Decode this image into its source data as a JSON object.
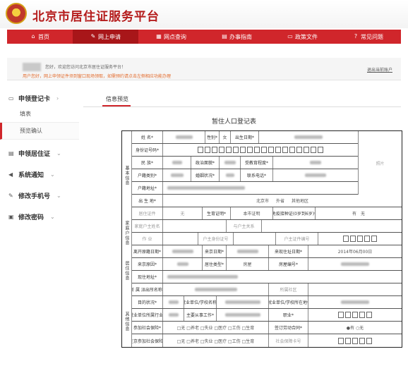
{
  "header": {
    "title": "北京市居住证服务平台"
  },
  "nav": [
    {
      "label": "首页",
      "icon": "home-icon",
      "glyph": "⌂"
    },
    {
      "label": "网上申请",
      "icon": "edit-icon",
      "glyph": "✎",
      "active": true
    },
    {
      "label": "网点查询",
      "icon": "map-icon",
      "glyph": "▦"
    },
    {
      "label": "办事指南",
      "icon": "guide-icon",
      "glyph": "▤"
    },
    {
      "label": "政策文件",
      "icon": "document-icon",
      "glyph": "▭"
    },
    {
      "label": "常见问题",
      "icon": "question-icon",
      "glyph": "?"
    }
  ],
  "welcome": {
    "greeting": "您好，欢迎您访问北京市居住证服务平台！",
    "note": "用户您好，网上申领证件须到窗口现场领取，如需预约请点击左侧相应功能办理",
    "logout": "退出当前账户"
  },
  "sidebar": {
    "groups": [
      {
        "label": "申领登记卡",
        "icon": "id-card-icon",
        "glyph": "▭",
        "caret": "›"
      },
      {
        "label": "申领居住证",
        "icon": "card-icon",
        "glyph": "▤",
        "caret": "⌄"
      },
      {
        "label": "系统通知",
        "icon": "speaker-icon",
        "glyph": "◀",
        "caret": "⌄"
      },
      {
        "label": "修改手机号",
        "icon": "edit-icon",
        "glyph": "✎",
        "caret": "⌄"
      },
      {
        "label": "修改密码",
        "icon": "lock-icon",
        "glyph": "▣",
        "caret": "⌄"
      }
    ],
    "subitems": [
      "填表",
      "预览确认"
    ]
  },
  "main": {
    "tab": "信息预览",
    "form_title": "暂住人口登记表"
  },
  "form": {
    "sections": {
      "basic": "基本信息",
      "household": "家庭户信息",
      "residence": "居住信息",
      "other": "其他信息"
    },
    "photo": "照片",
    "labels": {
      "name": "姓 名*",
      "gender": "性别*",
      "gender_value": "女",
      "birth": "出生日期*",
      "id_no": "身份证号码*",
      "ethnic": "民 族*",
      "politics": "政治面貌*",
      "education": "受教育程度*",
      "hukou_type": "户籍类别*",
      "marriage": "婚姻状况*",
      "phone": "联系电话*",
      "hukou_addr": "户籍地址*",
      "birthplace": "出 生 地*",
      "bp_opt1": "北京市",
      "bp_opt2": "外省",
      "bp_opt3": "其他地区",
      "residence_cert": "居住证件",
      "reproductive_cert": "生育证明*",
      "has_cert_opt": "有",
      "none_opt": "无",
      "beijing_cert": "本市证明",
      "exempt": "免疫接种证(0岁到6岁)*",
      "yes_opt": "有",
      "family_head": "家庭户主姓名",
      "head_relation": "与户主关系",
      "work": "作 业",
      "head_id": "户主身份证号",
      "spouse_id": "户主证件编号",
      "leave_date": "离开原籍日期*",
      "arrive_date": "来京日期*",
      "arrive_addr_date": "来现住址日期*",
      "arrive_date_value": "2014年06月00日",
      "come_reason": "来京原因*",
      "live_type": "居住类型*",
      "live_type_value": "房屋",
      "house_no": "房屋编号*",
      "current_addr": "现住地址*",
      "residence_name": "所 属 派出所名称*",
      "community": "所属社区",
      "purpose": "目的状况*",
      "employer": "就业单位/学校名称*",
      "employer_addr": "就业单位/学校所在地*",
      "industry": "就业单位所属行业*",
      "work_type": "主要从事工作*",
      "job": "职业*",
      "social_insurance": "参加社会保险*",
      "insurance_opts": "□无 □养老 □失业 □医疗 □工伤 □生育",
      "labor_contract": "签订劳动合同*",
      "contract_opts": "●有 ○无",
      "living_insurance": "在京参加社会保险*",
      "living_insurance_opts": "□无 □养老 □失业 □医疗 □工伤 □生育",
      "social_no": "社会保障卡号"
    }
  }
}
